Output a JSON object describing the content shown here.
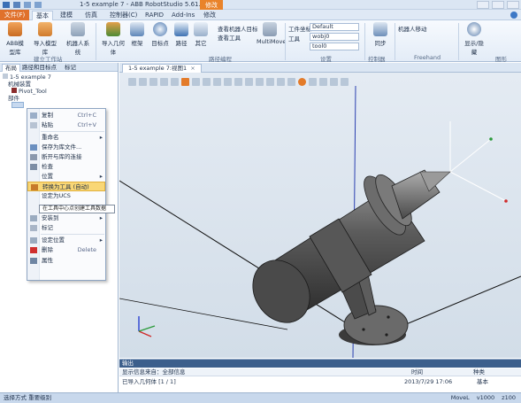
{
  "titlebar": {
    "title": "1-5 example 7 - ABB RobotStudio 5.61.01",
    "context_tab": "修改"
  },
  "ribbon_tabs": {
    "file": "文件(F)",
    "tabs": [
      "基本",
      "建模",
      "仿真",
      "控制器(C)",
      "RAPID",
      "Add-Ins",
      "修改"
    ]
  },
  "ribbon": {
    "groups": [
      {
        "label": "建立工作站",
        "buttons": [
          "ABB模型库",
          "导入模型库",
          "机器人系统"
        ]
      },
      {
        "label": "路径编程",
        "buttons": [
          "导入几何体",
          "框架",
          "目标点",
          "路径",
          "其它"
        ]
      },
      {
        "label": "设置",
        "items": [
          "查看机器人目标",
          "查看工具",
          "工件坐标",
          "工具"
        ]
      },
      {
        "label": "控制器",
        "buttons": [
          "同步"
        ]
      },
      {
        "label": "Freehand"
      },
      {
        "label": "图形",
        "buttons": [
          "显示/隐藏"
        ]
      }
    ],
    "combos": [
      "Default",
      "wobj0",
      "tool0"
    ],
    "multimove": "MultiMove",
    "freehand_select": "机器人移动"
  },
  "left_panel": {
    "tabs": [
      "布局",
      "路径和目标点",
      "标记"
    ],
    "tree": [
      "1-5 example 7",
      "机械装置",
      "Pivot_Tool",
      "部件"
    ]
  },
  "context_menu": {
    "items": [
      {
        "label": "复制",
        "shortcut": "Ctrl+C",
        "has_sub": false
      },
      {
        "label": "粘贴",
        "shortcut": "Ctrl+V",
        "has_sub": false
      },
      {
        "label": "重命名",
        "shortcut": "",
        "has_sub": true
      },
      {
        "label": "保存为库文件...",
        "shortcut": "",
        "has_sub": false
      },
      {
        "label": "断开与库的连接",
        "shortcut": "",
        "has_sub": false
      },
      {
        "label": "检查",
        "shortcut": "",
        "has_sub": false
      },
      {
        "label": "位置",
        "shortcut": "",
        "has_sub": true
      },
      {
        "label": "设定为UCS",
        "shortcut": "",
        "has_sub": false
      },
      {
        "label": "安装到",
        "shortcut": "",
        "has_sub": true
      },
      {
        "label": "标记",
        "shortcut": "",
        "has_sub": false
      },
      {
        "label": "设定位置",
        "shortcut": "",
        "has_sub": false
      },
      {
        "label": "删除",
        "shortcut": "Delete",
        "has_sub": false
      },
      {
        "label": "属性",
        "shortcut": "",
        "has_sub": false
      }
    ],
    "highlighted": "转换为工具 (自动)",
    "tooltip": "在工具中心点创建工具数据"
  },
  "document": {
    "tab_label": "1-5 example 7:视图1",
    "close_glyph": "×"
  },
  "output": {
    "title": "输出",
    "headers": [
      "显示信息来自：全部信息",
      "时间",
      "种类"
    ],
    "row": [
      "已导入几何体 [1 / 1]",
      "2013/7/29 17:06",
      "基本"
    ]
  },
  "statusbar": {
    "left": "选择方式 重要级别",
    "items": [
      "MoveL",
      "v1000",
      "z100"
    ]
  },
  "colors": {
    "file_tab": "#e0712c",
    "highlight": "#f9d776",
    "ribbon_bg": "#e3ecf7",
    "viewport_bg": "#d9e3ee"
  }
}
